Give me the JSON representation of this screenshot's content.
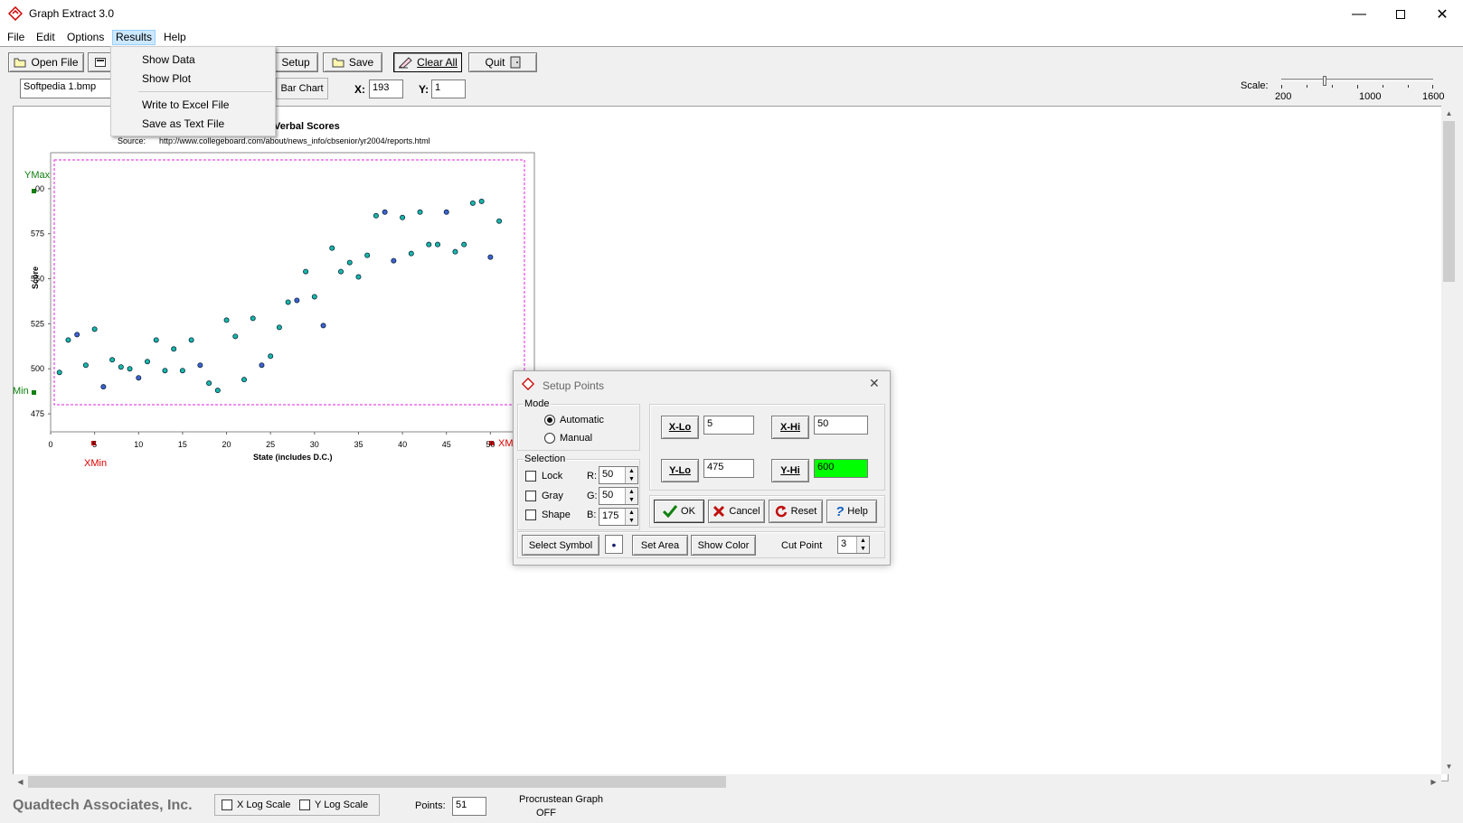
{
  "window": {
    "title": "Graph Extract 3.0"
  },
  "menu": [
    "File",
    "Edit",
    "Options",
    "Results",
    "Help"
  ],
  "results_menu": {
    "items": [
      "Show Data",
      "Show Plot",
      "Write to Excel File",
      "Save as Text File"
    ]
  },
  "toolbar": {
    "open_file": "Open File",
    "setup": "Setup",
    "save": "Save",
    "clear_all": "Clear All",
    "quit": "Quit",
    "file_name": "Softpedia 1.bmp",
    "chart_type": "Bar Chart",
    "x_label": "X:",
    "x_value": "193",
    "y_label": "Y:",
    "y_value": "1",
    "scale_label": "Scale:",
    "scale_ticks": [
      "200",
      "1000",
      "1600"
    ],
    "scale_value": 600
  },
  "plot": {
    "title": "Verbal Scores",
    "source_label": "Source:",
    "source_url": "http://www.collegeboard.com/about/news_info/cbsenior/yr2004/reports.html",
    "xlabel": "State (includes D.C.)",
    "ylabel": "Score",
    "ymax_marker": "YMax",
    "ymin_marker": "Min",
    "xmin_marker": "XMin",
    "xmax_marker": "XM",
    "x_ticks": [
      "0",
      "5",
      "10",
      "15",
      "20",
      "25",
      "30",
      "35",
      "40",
      "45",
      "50"
    ],
    "y_ticks": [
      "475",
      "500",
      "525",
      "550",
      "575",
      "00"
    ],
    "xlim": [
      0,
      55
    ],
    "ylim": [
      465,
      620
    ],
    "points": [
      [
        1,
        498
      ],
      [
        2,
        516
      ],
      [
        3,
        519
      ],
      [
        4,
        502
      ],
      [
        5,
        522
      ],
      [
        6,
        490
      ],
      [
        7,
        505
      ],
      [
        8,
        501
      ],
      [
        9,
        500
      ],
      [
        10,
        495
      ],
      [
        11,
        504
      ],
      [
        12,
        516
      ],
      [
        13,
        499
      ],
      [
        14,
        511
      ],
      [
        15,
        499
      ],
      [
        16,
        516
      ],
      [
        17,
        502
      ],
      [
        18,
        492
      ],
      [
        19,
        488
      ],
      [
        20,
        527
      ],
      [
        21,
        518
      ],
      [
        22,
        494
      ],
      [
        23,
        528
      ],
      [
        24,
        502
      ],
      [
        25,
        507
      ],
      [
        26,
        523
      ],
      [
        27,
        537
      ],
      [
        28,
        538
      ],
      [
        29,
        554
      ],
      [
        30,
        540
      ],
      [
        31,
        524
      ],
      [
        32,
        567
      ],
      [
        33,
        554
      ],
      [
        34,
        559
      ],
      [
        35,
        551
      ],
      [
        36,
        563
      ],
      [
        37,
        585
      ],
      [
        38,
        587
      ],
      [
        39,
        560
      ],
      [
        40,
        584
      ],
      [
        41,
        564
      ],
      [
        42,
        587
      ],
      [
        43,
        569
      ],
      [
        44,
        569
      ],
      [
        45,
        587
      ],
      [
        46,
        565
      ],
      [
        47,
        569
      ],
      [
        48,
        592
      ],
      [
        49,
        593
      ],
      [
        50,
        562
      ],
      [
        51,
        582
      ]
    ]
  },
  "dialog": {
    "title": "Setup Points",
    "mode_label": "Mode",
    "automatic": "Automatic",
    "manual": "Manual",
    "selection_label": "Selection",
    "lock": "Lock",
    "gray": "Gray",
    "shape": "Shape",
    "r_label": "R:",
    "r_value": "50",
    "g_label": "G:",
    "g_value": "50",
    "b_label": "B:",
    "b_value": "175",
    "xlo_label": "X-Lo",
    "xlo_value": "5",
    "xhi_label": "X-Hi",
    "xhi_value": "50",
    "ylo_label": "Y-Lo",
    "ylo_value": "475",
    "yhi_label": "Y-Hi",
    "yhi_value": "600",
    "ok": "OK",
    "cancel": "Cancel",
    "reset": "Reset",
    "help": "Help",
    "select_symbol": "Select Symbol",
    "symbol": "•",
    "set_area": "Set Area",
    "show_color": "Show Color",
    "cut_point_label": "Cut Point",
    "cut_point_value": "3",
    "yhi_color": "#00ff00"
  },
  "status": {
    "company": "Quadtech Associates, Inc.",
    "x_log": "X Log Scale",
    "y_log": "Y Log Scale",
    "points_label": "Points:",
    "points_value": "51",
    "procrustean": "Procrustean Graph",
    "procrustean_state": "OFF"
  }
}
